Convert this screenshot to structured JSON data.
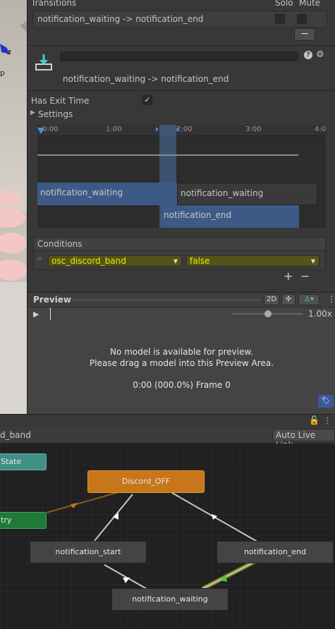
{
  "inspector": {
    "transitions_header": "Transitions",
    "solo_label": "Solo",
    "mute_label": "Mute",
    "transition_item": "notification_waiting -> notification_end",
    "minus": "−",
    "transition_title": "notification_waiting -> notification_end",
    "has_exit_time_label": "Has Exit Time",
    "has_exit_time_checked": "✓",
    "settings_label": "Settings",
    "help_icon": "?",
    "gear_icon": "⚙"
  },
  "timeline": {
    "ticks": [
      "0:00",
      "1:00",
      "2:00",
      "3:00",
      "4:0"
    ],
    "clip_source_1": "notification_waiting",
    "clip_source_2": "notification_waiting",
    "clip_dest": "notification_end"
  },
  "conditions": {
    "header": "Conditions",
    "parameter": "osc_discord_band",
    "value": "false",
    "add": "+",
    "remove": "−"
  },
  "preview": {
    "title": "Preview",
    "mode_2d": "2D",
    "speed": "1.00x",
    "message_line1": "No model is available for preview.",
    "message_line2": "Please drag a model into this Preview Area.",
    "time_readout": "0:00 (000.0%) Frame 0"
  },
  "graph": {
    "breadcrumb": "d_band",
    "auto_live_link": "Auto Live Link",
    "nodes": {
      "any_state": "State",
      "entry": "try",
      "discord_off": "Discord_OFF",
      "notification_start": "notification_start",
      "notification_end": "notification_end",
      "notification_waiting": "notification_waiting"
    }
  },
  "scene": {
    "axis_label": "z",
    "persp_label": "p"
  },
  "colors": {
    "highlight_yellow": "#f2e600",
    "orange_node": "#c8761a",
    "entry_green": "#1f7a3a",
    "anystate_teal": "#3f8f86",
    "clip_blue": "#3d5a86"
  }
}
